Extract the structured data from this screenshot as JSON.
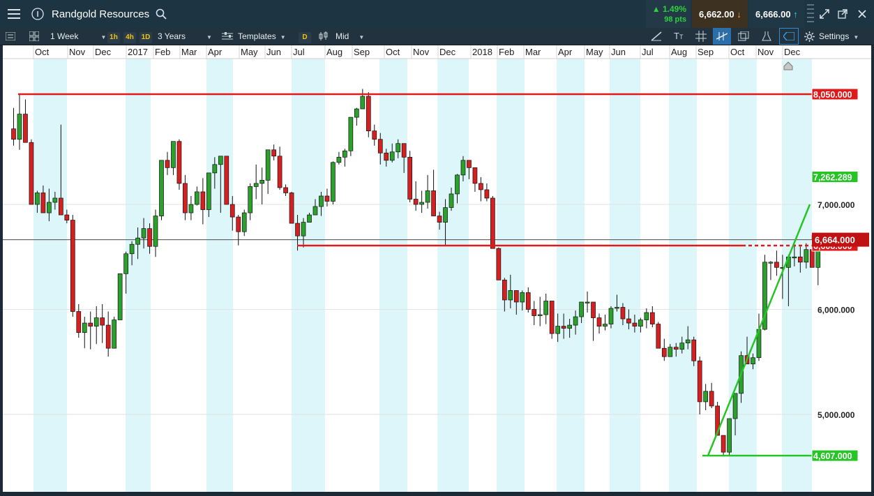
{
  "header": {
    "title": "Randgold Resources",
    "change_pct": "▲ 1.49%",
    "change_pts": "98 pts",
    "sell_price": "6,662.00",
    "buy_price": "6,666.00"
  },
  "toolbar": {
    "interval": "1 Week",
    "btn_1h": "1h",
    "btn_4h": "4h",
    "btn_1d": "1D",
    "range": "3 Years",
    "templates": "Templates",
    "btn_d": "D",
    "price_mode": "Mid",
    "text_tool": "T",
    "settings": "Settings"
  },
  "colors": {
    "up": "#2ca02c",
    "down": "#d42020",
    "band": "#dcf6fa",
    "resistance": "#e01a1a",
    "trend": "#24c524",
    "current_price_box": "#c01212"
  },
  "chart_data": {
    "type": "candlestick",
    "interval": "1 Week",
    "ylim": [
      4400,
      8350
    ],
    "x_tick_labels": [
      "Oct",
      "Nov",
      "Dec",
      "2017",
      "Feb",
      "Mar",
      "Apr",
      "May",
      "Jun",
      "Jul",
      "Aug",
      "Sep",
      "Oct",
      "Nov",
      "Dec",
      "2018",
      "Feb",
      "Mar",
      "Apr",
      "May",
      "Jun",
      "Jul",
      "Aug",
      "Sep",
      "Oct",
      "Nov",
      "Dec"
    ],
    "y_tick_labels": [
      "7,000.000",
      "6,000.000",
      "5,000.000"
    ],
    "price_labels": {
      "resistance": "8,050.000",
      "upper": "7,262.289",
      "current": "6,664.000",
      "support_line": "6,608.000",
      "low": "4,607.000"
    },
    "current_price": 6664,
    "horizontal_lines": [
      {
        "name": "resistance",
        "value": 8050
      },
      {
        "name": "support",
        "value": 6608
      },
      {
        "name": "low",
        "value": 4607
      }
    ],
    "candles": [
      [
        7720,
        7920,
        7560,
        7620
      ],
      [
        7620,
        8050,
        7520,
        7860
      ],
      [
        7860,
        8000,
        7650,
        7590
      ],
      [
        7590,
        7620,
        7050,
        7000
      ],
      [
        7000,
        7130,
        6920,
        7110
      ],
      [
        7110,
        7180,
        6970,
        6920
      ],
      [
        6920,
        7150,
        6840,
        7020
      ],
      [
        7020,
        7120,
        6950,
        7060
      ],
      [
        7060,
        7760,
        6980,
        6900
      ],
      [
        6900,
        6950,
        6820,
        6850
      ],
      [
        6850,
        6900,
        5930,
        5980
      ],
      [
        5980,
        6050,
        5730,
        5780
      ],
      [
        5780,
        5930,
        5630,
        5870
      ],
      [
        5870,
        5980,
        5620,
        5840
      ],
      [
        5840,
        6030,
        5670,
        5920
      ],
      [
        5920,
        6050,
        5680,
        5850
      ],
      [
        5850,
        5980,
        5550,
        5630
      ],
      [
        5630,
        5930,
        5650,
        5900
      ],
      [
        5900,
        6300,
        5900,
        6340
      ],
      [
        6340,
        6550,
        6150,
        6530
      ],
      [
        6530,
        6650,
        6420,
        6620
      ],
      [
        6620,
        6780,
        6480,
        6680
      ],
      [
        6680,
        6870,
        6580,
        6770
      ],
      [
        6770,
        6820,
        6530,
        6600
      ],
      [
        6600,
        6950,
        6500,
        6890
      ],
      [
        6890,
        7380,
        6850,
        7420
      ],
      [
        7420,
        7500,
        7280,
        7350
      ],
      [
        7350,
        7600,
        7280,
        7600
      ],
      [
        7600,
        7620,
        7140,
        7200
      ],
      [
        7200,
        7280,
        6850,
        6920
      ],
      [
        6920,
        7080,
        6850,
        7000
      ],
      [
        7000,
        7170,
        6990,
        7120
      ],
      [
        7120,
        7250,
        6810,
        6950
      ],
      [
        6950,
        7180,
        6880,
        7300
      ],
      [
        7300,
        7450,
        7150,
        7380
      ],
      [
        7380,
        7430,
        6920,
        7460
      ],
      [
        7460,
        7450,
        7000,
        7000
      ],
      [
        7000,
        7080,
        6750,
        6880
      ],
      [
        6880,
        6900,
        6610,
        6740
      ],
      [
        6740,
        6950,
        6700,
        6920
      ],
      [
        6920,
        7200,
        6850,
        7170
      ],
      [
        7170,
        7380,
        7050,
        7200
      ],
      [
        7200,
        7350,
        7000,
        7230
      ],
      [
        7230,
        7520,
        7100,
        7520
      ],
      [
        7520,
        7570,
        7420,
        7460
      ],
      [
        7460,
        7550,
        7140,
        7160
      ],
      [
        7160,
        7190,
        7080,
        7110
      ],
      [
        7110,
        7120,
        6850,
        6820
      ],
      [
        6820,
        6900,
        6560,
        6700
      ],
      [
        6700,
        6870,
        6590,
        6830
      ],
      [
        6830,
        6920,
        6840,
        6900
      ],
      [
        6900,
        7050,
        6900,
        6980
      ],
      [
        6980,
        7120,
        6890,
        7080
      ],
      [
        7080,
        7150,
        6980,
        7030
      ],
      [
        7030,
        7410,
        7000,
        7400
      ],
      [
        7400,
        7500,
        7380,
        7450
      ],
      [
        7450,
        7530,
        7360,
        7510
      ],
      [
        7510,
        7620,
        7460,
        7830
      ],
      [
        7830,
        7920,
        7750,
        7910
      ],
      [
        7910,
        8100,
        8020,
        8030
      ],
      [
        8030,
        8070,
        7640,
        7700
      ],
      [
        7700,
        7760,
        7560,
        7620
      ],
      [
        7620,
        7680,
        7380,
        7490
      ],
      [
        7490,
        7530,
        7360,
        7420
      ],
      [
        7420,
        7580,
        7400,
        7500
      ],
      [
        7500,
        7620,
        7440,
        7580
      ],
      [
        7580,
        7580,
        7300,
        7450
      ],
      [
        7450,
        7510,
        7020,
        7050
      ],
      [
        7050,
        7220,
        6940,
        7000
      ],
      [
        7000,
        7130,
        6920,
        7020
      ],
      [
        7020,
        7280,
        6960,
        7130
      ],
      [
        7130,
        7330,
        6930,
        6890
      ],
      [
        6890,
        6930,
        6760,
        6830
      ],
      [
        6830,
        7050,
        6610,
        6970
      ],
      [
        6970,
        7160,
        6940,
        7100
      ],
      [
        7100,
        7290,
        7010,
        7280
      ],
      [
        7280,
        7460,
        7220,
        7420
      ],
      [
        7420,
        7420,
        7240,
        7350
      ],
      [
        7350,
        7260,
        7120,
        7200
      ],
      [
        7200,
        7260,
        7030,
        7140
      ],
      [
        7140,
        7200,
        7030,
        7060
      ],
      [
        7060,
        7080,
        6770,
        6580
      ],
      [
        6580,
        6590,
        6280,
        6280
      ],
      [
        6280,
        6300,
        5980,
        6090
      ],
      [
        6090,
        6330,
        6010,
        6180
      ],
      [
        6180,
        6180,
        5950,
        6070
      ],
      [
        6070,
        6180,
        5990,
        6160
      ],
      [
        6160,
        6210,
        5970,
        6000
      ],
      [
        6000,
        6080,
        5850,
        5940
      ],
      [
        5940,
        6120,
        5840,
        5950
      ],
      [
        5950,
        6150,
        5860,
        6080
      ],
      [
        6080,
        6000,
        5720,
        5770
      ],
      [
        5770,
        5960,
        5690,
        5840
      ],
      [
        5840,
        5960,
        5720,
        5820
      ],
      [
        5820,
        5910,
        5730,
        5850
      ],
      [
        5850,
        5990,
        5760,
        5930
      ],
      [
        5930,
        6070,
        5870,
        6070
      ],
      [
        6070,
        6170,
        5970,
        6070
      ],
      [
        6070,
        6070,
        5700,
        5920
      ],
      [
        5920,
        5960,
        5770,
        5840
      ],
      [
        5840,
        5950,
        5800,
        5860
      ],
      [
        5860,
        6030,
        5820,
        6010
      ],
      [
        6010,
        6140,
        5980,
        6020
      ],
      [
        6020,
        6060,
        5850,
        5910
      ],
      [
        5910,
        6000,
        5810,
        5870
      ],
      [
        5870,
        5950,
        5780,
        5840
      ],
      [
        5840,
        5920,
        5780,
        5900
      ],
      [
        5900,
        6010,
        5820,
        5970
      ],
      [
        5970,
        6030,
        5830,
        5860
      ],
      [
        5860,
        5880,
        5690,
        5630
      ],
      [
        5630,
        5720,
        5510,
        5550
      ],
      [
        5550,
        5670,
        5550,
        5640
      ],
      [
        5640,
        5680,
        5550,
        5620
      ],
      [
        5620,
        5740,
        5580,
        5680
      ],
      [
        5680,
        5840,
        5620,
        5710
      ],
      [
        5710,
        5740,
        5460,
        5510
      ],
      [
        5510,
        5550,
        5000,
        5120
      ],
      [
        5120,
        5290,
        5040,
        5220
      ],
      [
        5220,
        5300,
        5060,
        5080
      ],
      [
        5080,
        5120,
        4870,
        4800
      ],
      [
        4800,
        4700,
        4600,
        4640
      ],
      [
        4640,
        4950,
        4607,
        4960
      ],
      [
        4960,
        5000,
        4800,
        5200
      ],
      [
        5200,
        5600,
        5110,
        5560
      ],
      [
        5560,
        5740,
        5520,
        5480
      ],
      [
        5480,
        5580,
        5430,
        5540
      ],
      [
        5540,
        5960,
        5510,
        5810
      ],
      [
        5810,
        6520,
        5800,
        6450
      ],
      [
        6450,
        6460,
        6280,
        6450
      ],
      [
        6450,
        6560,
        6320,
        6400
      ],
      [
        6400,
        6520,
        6100,
        6400
      ],
      [
        6400,
        6520,
        6030,
        6500
      ],
      [
        6500,
        6620,
        6410,
        6500
      ],
      [
        6500,
        6600,
        6350,
        6450
      ],
      [
        6450,
        6630,
        6390,
        6570
      ],
      [
        6570,
        6710,
        6400,
        6400
      ],
      [
        6400,
        6640,
        6230,
        6664
      ]
    ]
  }
}
